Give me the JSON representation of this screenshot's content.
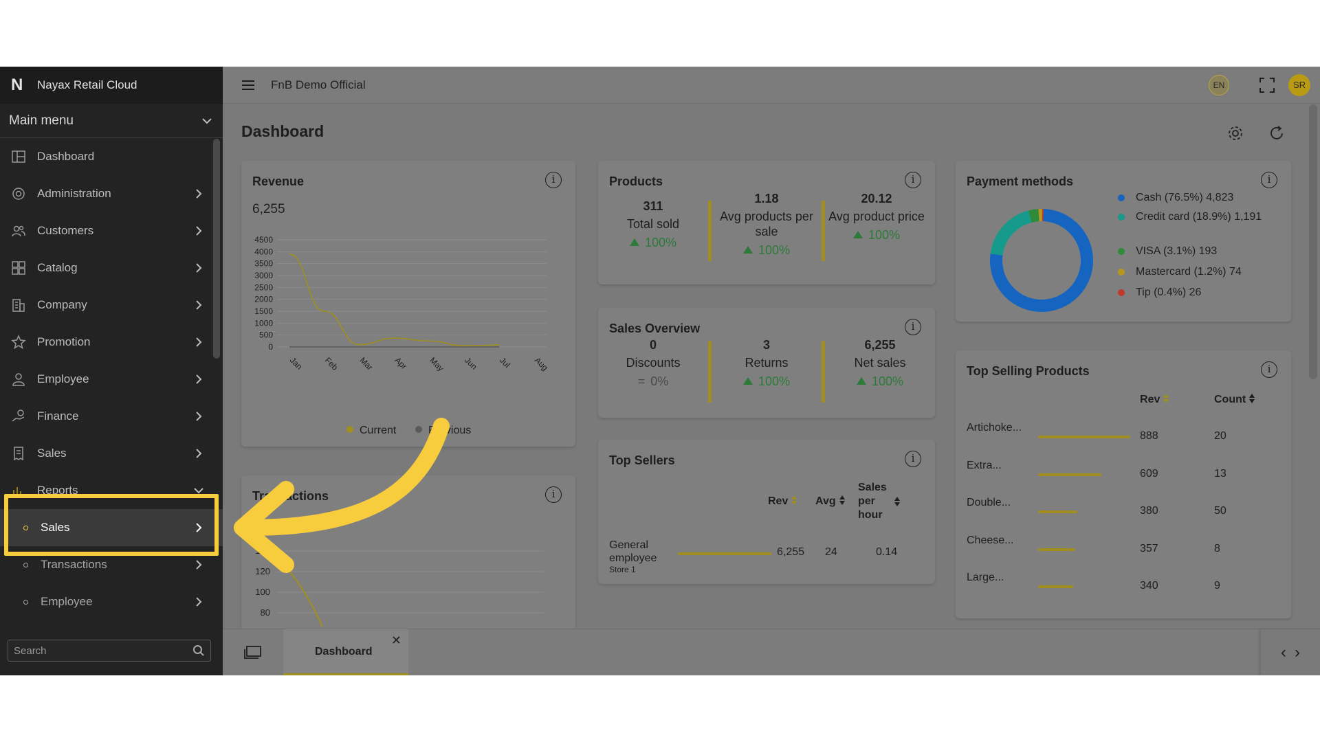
{
  "app": {
    "brand": "Nayax Retail Cloud",
    "org": "FnB Demo Official",
    "lang": "EN",
    "user_initials": "SR"
  },
  "sidebar": {
    "main_menu": "Main menu",
    "items": [
      {
        "label": "Dashboard",
        "icon": "dashboard-icon"
      },
      {
        "label": "Administration",
        "icon": "gear-icon"
      },
      {
        "label": "Customers",
        "icon": "users-icon"
      },
      {
        "label": "Catalog",
        "icon": "grid-icon"
      },
      {
        "label": "Company",
        "icon": "building-icon"
      },
      {
        "label": "Promotion",
        "icon": "star-icon"
      },
      {
        "label": "Employee",
        "icon": "person-icon"
      },
      {
        "label": "Finance",
        "icon": "hand-coin-icon"
      },
      {
        "label": "Sales",
        "icon": "receipt-icon"
      },
      {
        "label": "Reports",
        "icon": "bar-chart-icon"
      }
    ],
    "report_subitems": [
      "Sales",
      "Transactions",
      "Employee"
    ],
    "search_placeholder": "Search"
  },
  "page": {
    "title": "Dashboard"
  },
  "revenue": {
    "title": "Revenue",
    "total": "6,255",
    "legend_current": "Current",
    "legend_previous": "Previous"
  },
  "products": {
    "title": "Products",
    "stats": [
      {
        "value": "311",
        "label": "Total sold",
        "change": "100%"
      },
      {
        "value": "1.18",
        "label": "Avg products per sale",
        "change": "100%"
      },
      {
        "value": "20.12",
        "label": "Avg product price",
        "change": "100%"
      }
    ]
  },
  "sales_overview": {
    "title": "Sales Overview",
    "stats": [
      {
        "value": "0",
        "label": "Discounts",
        "change": "0%"
      },
      {
        "value": "3",
        "label": "Returns",
        "change": "100%"
      },
      {
        "value": "6,255",
        "label": "Net sales",
        "change": "100%"
      }
    ]
  },
  "top_sellers": {
    "title": "Top Sellers",
    "headers": {
      "rev": "Rev",
      "avg": "Avg",
      "sph": "Sales per hour"
    },
    "rows": [
      {
        "name": "General employee",
        "store": "Store 1",
        "rev": "6,255",
        "avg": "24",
        "sph": "0.14"
      }
    ]
  },
  "payment_methods": {
    "title": "Payment methods",
    "items": [
      {
        "label": "Cash (76.5%) 4,823",
        "color": "#1565c0",
        "share": 76.5
      },
      {
        "label": "Credit card (18.9%) 1,191",
        "color": "#159a8c",
        "share": 18.9
      },
      {
        "label": "VISA (3.1%) 193",
        "color": "#2e8b3a",
        "share": 3.1
      },
      {
        "label": "Mastercard (1.2%) 74",
        "color": "#b8961e",
        "share": 1.2
      },
      {
        "label": "Tip (0.4%) 26",
        "color": "#c0392b",
        "share": 0.4
      }
    ]
  },
  "top_selling": {
    "title": "Top Selling Products",
    "headers": {
      "rev": "Rev",
      "count": "Count"
    },
    "rows": [
      {
        "name": "Artichoke...",
        "rev": "888",
        "count": "20",
        "rev_value": 888
      },
      {
        "name": "Extra...",
        "rev": "609",
        "count": "13",
        "rev_value": 609
      },
      {
        "name": "Double...",
        "rev": "380",
        "count": "50",
        "rev_value": 380
      },
      {
        "name": "Cheese...",
        "rev": "357",
        "count": "8",
        "rev_value": 357
      },
      {
        "name": "Large...",
        "rev": "340",
        "count": "9",
        "rev_value": 340
      }
    ]
  },
  "transactions": {
    "title": "Transactions",
    "y_ticks_visible": [
      "140",
      "120",
      "100",
      "80"
    ]
  },
  "tabs": [
    {
      "label": "Dashboard"
    }
  ],
  "chart_data": {
    "type": "line",
    "title": "Revenue",
    "categories": [
      "Jan",
      "Feb",
      "Mar",
      "Apr",
      "May",
      "Jun",
      "Jul",
      "Aug"
    ],
    "series": [
      {
        "name": "Current",
        "color": "#a08f1e",
        "values": [
          3900,
          1500,
          100,
          370,
          250,
          50,
          80,
          null
        ]
      },
      {
        "name": "Previous",
        "color": "#5a5a5a",
        "values": [
          0,
          0,
          0,
          0,
          0,
          0,
          0,
          null
        ]
      }
    ],
    "y_ticks": [
      0,
      500,
      1000,
      1500,
      2000,
      2500,
      3000,
      3500,
      4000,
      4500
    ],
    "ylim": [
      0,
      4500
    ],
    "grid": true,
    "legend": "bottom"
  }
}
